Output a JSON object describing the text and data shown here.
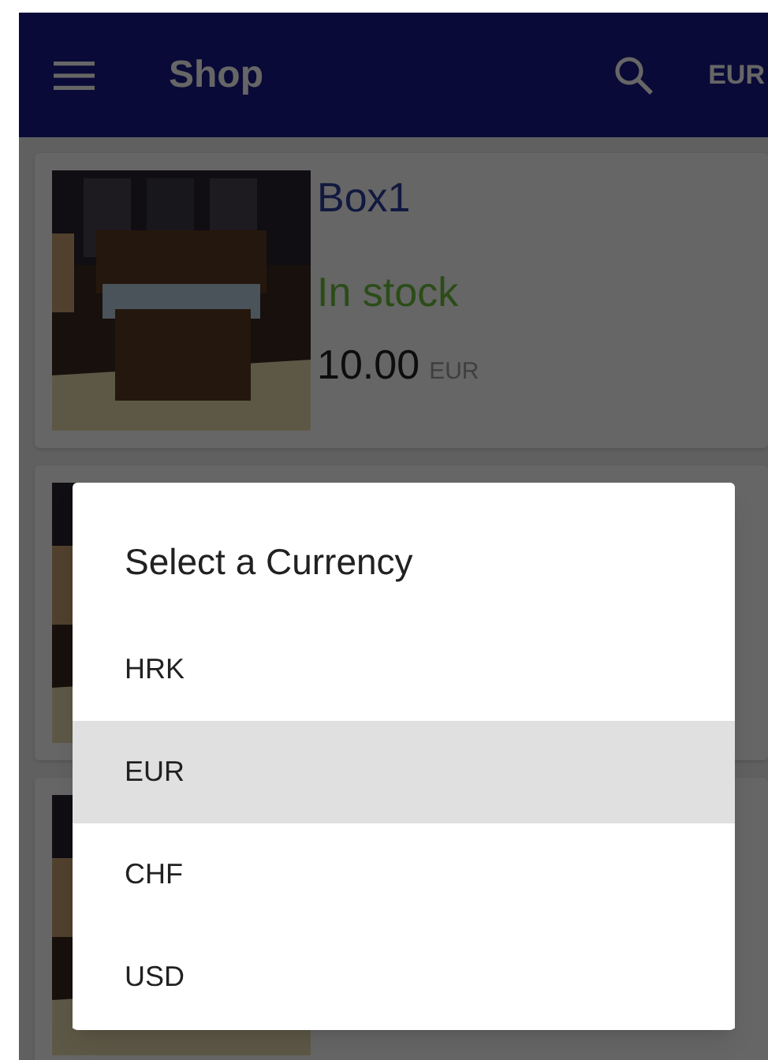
{
  "toolbar": {
    "title": "Shop",
    "currency": "EUR"
  },
  "products": [
    {
      "name": "Box1",
      "stock": "In stock",
      "price": "10.00",
      "currency": "EUR",
      "image": {
        "kind": "picture"
      }
    },
    {
      "image": {
        "kind": "picture"
      }
    },
    {
      "image": {
        "kind": "picture"
      }
    }
  ],
  "dialog": {
    "title": "Select a Currency",
    "options": [
      {
        "label": "HRK",
        "selected": false
      },
      {
        "label": "EUR",
        "selected": true
      },
      {
        "label": "CHF",
        "selected": false
      },
      {
        "label": "USD",
        "selected": false
      }
    ]
  }
}
